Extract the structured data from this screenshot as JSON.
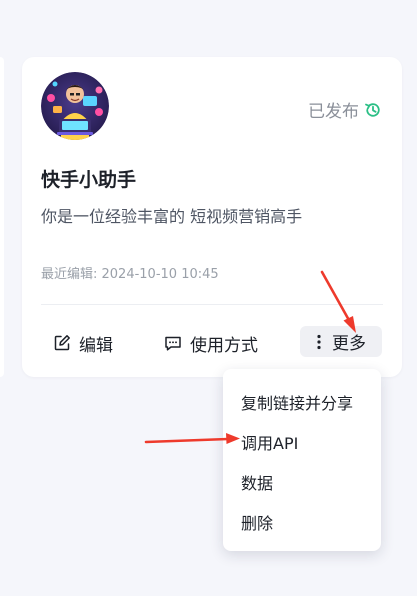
{
  "card": {
    "status": "已发布",
    "title": "快手小助手",
    "description": "你是一位经验丰富的 短视频营销高手",
    "edited": "最近编辑: 2024-10-10 10:45",
    "actions": {
      "edit": "编辑",
      "usage": "使用方式",
      "more": "更多"
    }
  },
  "dropdown": {
    "items": [
      "复制链接并分享",
      "调用API",
      "数据",
      "删除"
    ]
  },
  "icons": {
    "status": "history-icon",
    "edit": "edit-square-icon",
    "usage": "message-icon",
    "more": "more-vertical-icon"
  },
  "colors": {
    "status_icon": "#2bbf86",
    "arrow": "#ee3a2c"
  }
}
